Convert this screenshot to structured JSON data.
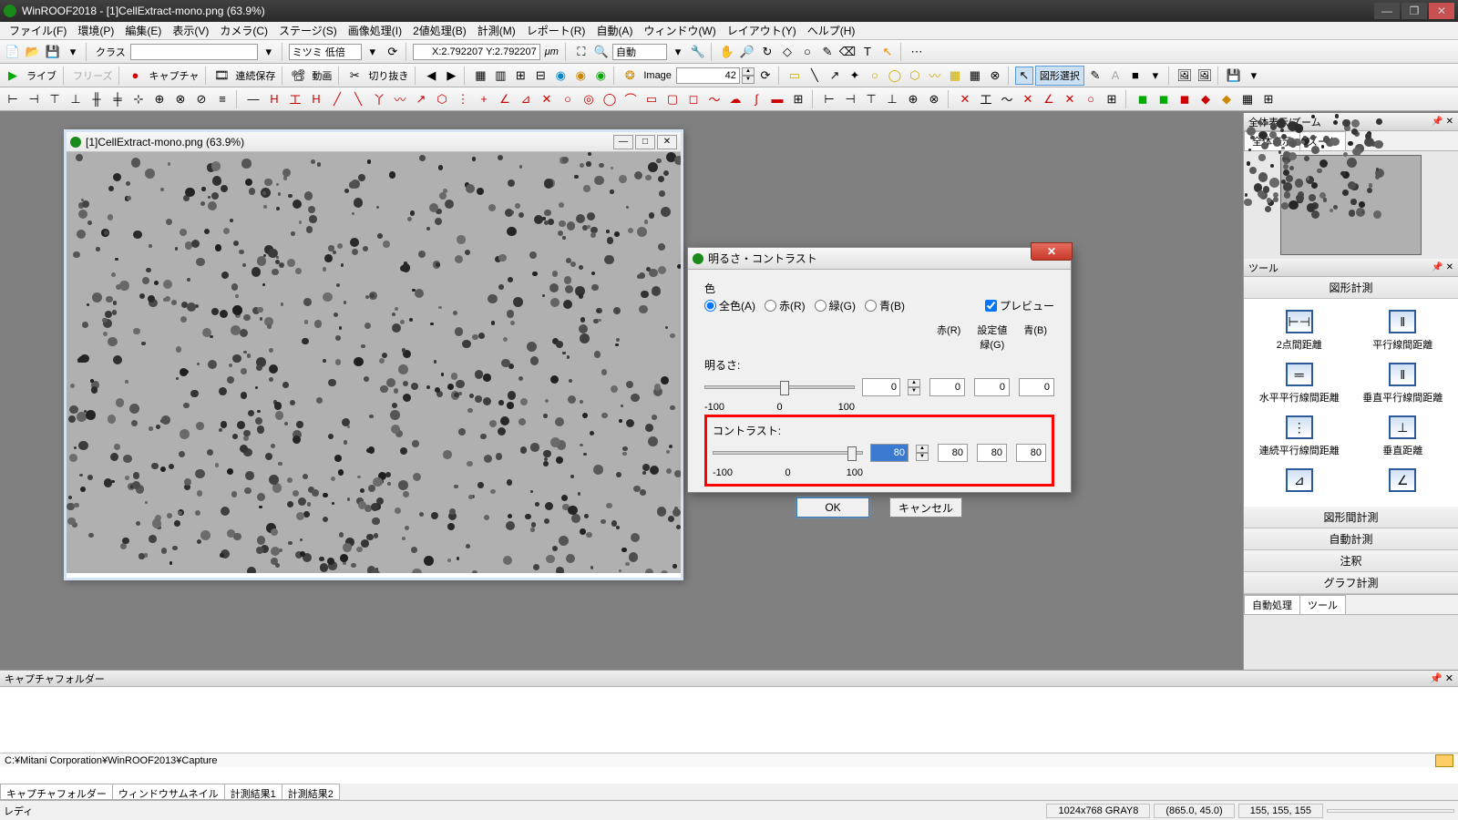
{
  "app": {
    "title": "WinROOF2018 - [1]CellExtract-mono.png (63.9%)"
  },
  "menu": [
    "ファイル(F)",
    "環境(P)",
    "編集(E)",
    "表示(V)",
    "カメラ(C)",
    "ステージ(S)",
    "画像処理(I)",
    "2値処理(B)",
    "計測(M)",
    "レポート(R)",
    "自動(A)",
    "ウィンドウ(W)",
    "レイアウト(Y)",
    "ヘルプ(H)"
  ],
  "toolbar1": {
    "class_label": "クラス",
    "coord": "X:2.792207 Y:2.792207",
    "unit": "μm",
    "mitsumi": "ミツミ 低倍",
    "auto": "自動"
  },
  "toolbar2": {
    "live": "ライブ",
    "freeze": "フリーズ",
    "capture": "キャプチャ",
    "cont_save": "連続保存",
    "movie": "動画",
    "crop": "切り抜き",
    "image_label": "Image",
    "image_val": "42",
    "shape_select": "図形選択"
  },
  "doc": {
    "title": "[1]CellExtract-mono.png (63.9%)"
  },
  "dialog": {
    "title": "明るさ・コントラスト",
    "color_label": "色",
    "radios": [
      "全色(A)",
      "赤(R)",
      "緑(G)",
      "青(B)"
    ],
    "preview": "プレビュー",
    "col_headers": [
      "赤(R)",
      "設定値\n緑(G)",
      "青(B)"
    ],
    "brightness": {
      "label": "明るさ:",
      "value": "0",
      "r": "0",
      "g": "0",
      "b": "0"
    },
    "contrast": {
      "label": "コントラスト:",
      "value": "80",
      "r": "80",
      "g": "80",
      "b": "80"
    },
    "scale": [
      "-100",
      "0",
      "100"
    ],
    "ok": "OK",
    "cancel": "キャンセル"
  },
  "right": {
    "overview_title": "全体表示/ズーム",
    "overview_tabs": [
      "全体表示",
      "ズーム"
    ],
    "tools_title": "ツール",
    "shape_meas": "図形計測",
    "tools": [
      {
        "lbl": "2点間距離"
      },
      {
        "lbl": "平行線間距離"
      },
      {
        "lbl": "水平平行線間距離"
      },
      {
        "lbl": "垂直平行線間距離"
      },
      {
        "lbl": "連続平行線間距離"
      },
      {
        "lbl": "垂直距離"
      },
      {
        "lbl": ""
      },
      {
        "lbl": ""
      }
    ],
    "sections": [
      "図形間計測",
      "自動計測",
      "注釈",
      "グラフ計測"
    ],
    "bottom_tabs": [
      "自動処理",
      "ツール"
    ]
  },
  "capture": {
    "title": "キャプチャフォルダー",
    "path": "C:¥Mitani Corporation¥WinROOF2013¥Capture",
    "tabs": [
      "キャプチャフォルダー",
      "ウィンドウサムネイル",
      "計測結果1",
      "計測結果2"
    ]
  },
  "status": {
    "ready": "レディ",
    "dim": "1024x768 GRAY8",
    "coord": "(865.0, 45.0)",
    "rgb": "155, 155, 155"
  }
}
